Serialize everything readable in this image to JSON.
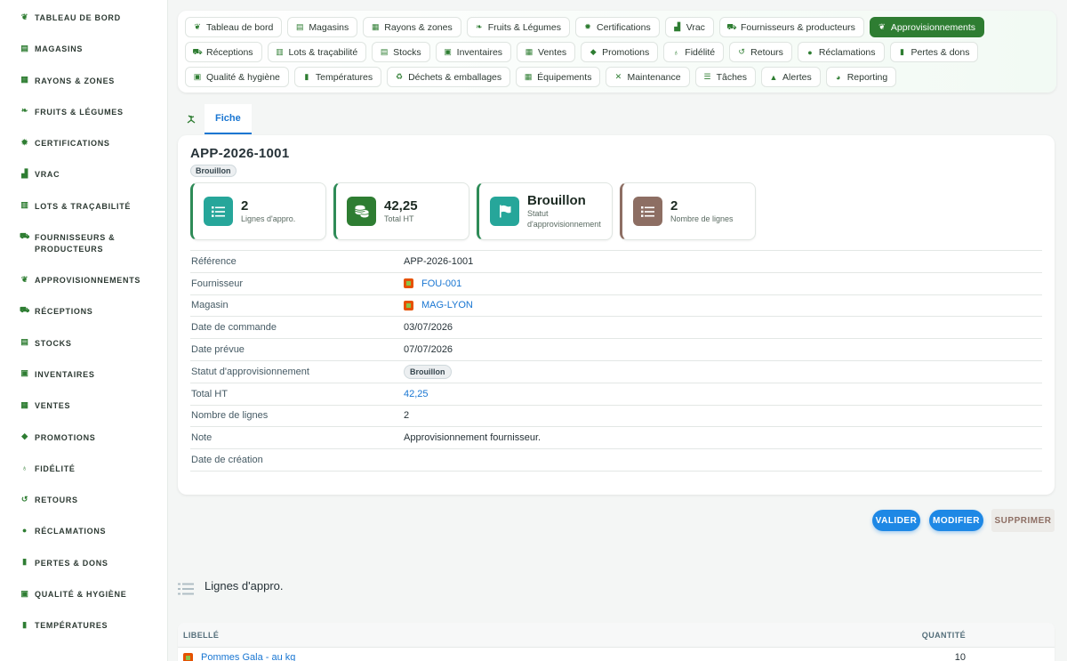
{
  "sidebar": {
    "items": [
      {
        "label": "TABLEAU DE BORD",
        "icon": "sprout-icon"
      },
      {
        "label": "MAGASINS",
        "icon": "store-icon"
      },
      {
        "label": "RAYONS & ZONES",
        "icon": "grid-icon"
      },
      {
        "label": "FRUITS & LÉGUMES",
        "icon": "leaf-icon"
      },
      {
        "label": "CERTIFICATIONS",
        "icon": "badge-icon"
      },
      {
        "label": "VRAC",
        "icon": "bins-icon"
      },
      {
        "label": "LOTS & TRAÇABILITÉ",
        "icon": "barcode-icon"
      },
      {
        "label": "FOURNISSEURS & PRODUCTEURS",
        "icon": "tractor-icon"
      },
      {
        "label": "APPROVISIONNEMENTS",
        "icon": "hand-plant-icon"
      },
      {
        "label": "RÉCEPTIONS",
        "icon": "truck-icon"
      },
      {
        "label": "STOCKS",
        "icon": "warehouse-icon"
      },
      {
        "label": "INVENTAIRES",
        "icon": "clipboard-icon"
      },
      {
        "label": "VENTES",
        "icon": "cash-register-icon"
      },
      {
        "label": "PROMOTIONS",
        "icon": "tag-icon"
      },
      {
        "label": "FIDÉLITÉ",
        "icon": "award-icon"
      },
      {
        "label": "RETOURS",
        "icon": "undo-icon"
      },
      {
        "label": "RÉCLAMATIONS",
        "icon": "chat-icon"
      },
      {
        "label": "PERTES & DONS",
        "icon": "trash-icon"
      },
      {
        "label": "QUALITÉ & HYGIÈNE",
        "icon": "check-clipboard-icon"
      },
      {
        "label": "TEMPÉRATURES",
        "icon": "thermometer-icon"
      }
    ]
  },
  "topnav": {
    "chips": [
      {
        "label": "Tableau de bord",
        "icon": "sprout-icon",
        "glyph": "❦"
      },
      {
        "label": "Magasins",
        "icon": "store-icon",
        "glyph": "▤"
      },
      {
        "label": "Rayons & zones",
        "icon": "grid-icon",
        "glyph": "▦"
      },
      {
        "label": "Fruits & Légumes",
        "icon": "leaf-icon",
        "glyph": "❧"
      },
      {
        "label": "Certifications",
        "icon": "badge-icon",
        "glyph": "✹"
      },
      {
        "label": "Vrac",
        "icon": "bins-icon",
        "glyph": "▟"
      },
      {
        "label": "Fournisseurs & producteurs",
        "icon": "tractor-icon",
        "glyph": "⛟"
      },
      {
        "label": "Approvisionnements",
        "icon": "hand-plant-icon",
        "glyph": "❦",
        "active": true
      },
      {
        "label": "Réceptions",
        "icon": "truck-icon",
        "glyph": "⛟"
      },
      {
        "label": "Lots & traçabilité",
        "icon": "barcode-icon",
        "glyph": "▥"
      },
      {
        "label": "Stocks",
        "icon": "warehouse-icon",
        "glyph": "▤"
      },
      {
        "label": "Inventaires",
        "icon": "clipboard-icon",
        "glyph": "▣"
      },
      {
        "label": "Ventes",
        "icon": "cash-register-icon",
        "glyph": "▦"
      },
      {
        "label": "Promotions",
        "icon": "tag-icon",
        "glyph": "◆"
      },
      {
        "label": "Fidélité",
        "icon": "award-icon",
        "glyph": "♁"
      },
      {
        "label": "Retours",
        "icon": "undo-icon",
        "glyph": "↺"
      },
      {
        "label": "Réclamations",
        "icon": "chat-icon",
        "glyph": "●"
      },
      {
        "label": "Pertes & dons",
        "icon": "trash-icon",
        "glyph": "▮"
      },
      {
        "label": "Qualité & hygiène",
        "icon": "check-clipboard-icon",
        "glyph": "▣"
      },
      {
        "label": "Températures",
        "icon": "thermometer-icon",
        "glyph": "▮"
      },
      {
        "label": "Déchets & emballages",
        "icon": "recycle-icon",
        "glyph": "♻"
      },
      {
        "label": "Équipements",
        "icon": "toolbox-icon",
        "glyph": "▦"
      },
      {
        "label": "Maintenance",
        "icon": "tools-icon",
        "glyph": "✕"
      },
      {
        "label": "Tâches",
        "icon": "tasks-icon",
        "glyph": "☰"
      },
      {
        "label": "Alertes",
        "icon": "bell-icon",
        "glyph": "▲"
      },
      {
        "label": "Reporting",
        "icon": "pie-chart-icon",
        "glyph": "◕"
      }
    ]
  },
  "tabs": {
    "active_label": "Fiche"
  },
  "record": {
    "title": "APP-2026-1001",
    "status_pill": "Brouillon",
    "kpis": [
      {
        "value": "2",
        "label": "Lignes d'appro.",
        "color": "#26a69a",
        "icon": "list-icon"
      },
      {
        "value": "42,25",
        "label": "Total HT",
        "color": "#2e7d32",
        "icon": "coins-icon"
      },
      {
        "value": "Brouillon",
        "label": "Statut d'approvisionnement",
        "color": "#26a69a",
        "icon": "flag-icon"
      },
      {
        "value": "2",
        "label": "Nombre de lignes",
        "color": "#8d6e63",
        "icon": "list-icon"
      }
    ],
    "fields": {
      "reference_label": "Référence",
      "reference_value": "APP-2026-1001",
      "fournisseur_label": "Fournisseur",
      "fournisseur_value": "FOU-001",
      "magasin_label": "Magasin",
      "magasin_value": "MAG-LYON",
      "date_commande_label": "Date de commande",
      "date_commande_value": "03/07/2026",
      "date_prevue_label": "Date prévue",
      "date_prevue_value": "07/07/2026",
      "statut_label": "Statut d'approvisionnement",
      "statut_value": "Brouillon",
      "total_label": "Total HT",
      "total_value": "42,25",
      "nb_lignes_label": "Nombre de lignes",
      "nb_lignes_value": "2",
      "note_label": "Note",
      "note_value": "Approvisionnement fournisseur.",
      "date_creation_label": "Date de création",
      "date_creation_value": ""
    }
  },
  "actions": {
    "validate": "VALIDER",
    "modify": "MODIFIER",
    "delete": "SUPPRIMER"
  },
  "lines": {
    "title": "Lignes d'appro.",
    "col_label": "LIBELLÉ",
    "col_qty": "QUANTITÉ",
    "rows": [
      {
        "label": "Pommes Gala - au kg",
        "qty": "10"
      }
    ]
  }
}
